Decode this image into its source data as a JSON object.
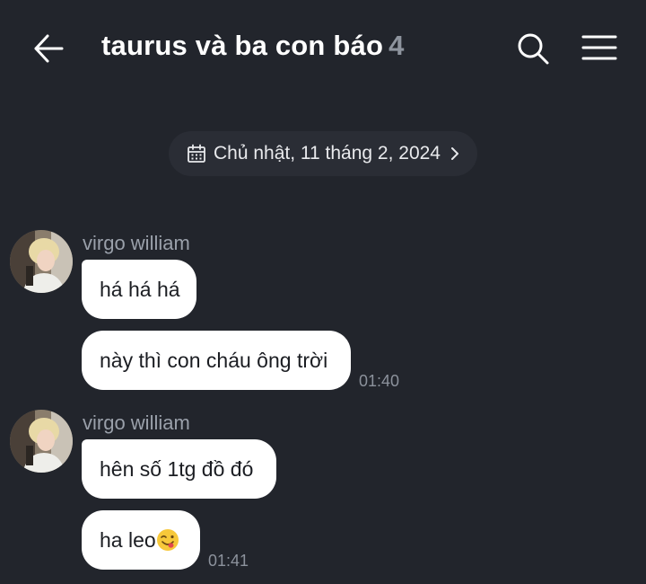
{
  "header": {
    "title": "taurus và ba con báo",
    "member_count": "4",
    "back_icon": "arrow-left-icon",
    "search_icon": "search-icon",
    "menu_icon": "hamburger-menu-icon"
  },
  "date_separator": {
    "label": "Chủ nhật, 11 tháng 2, 2024",
    "icon": "calendar-icon"
  },
  "colors": {
    "background": "#22252c",
    "bubble": "#ffffff",
    "sender_name": "#9aa0aa",
    "muted_count": "#8e949e"
  },
  "messages": [
    {
      "sender": "virgo william",
      "bubbles": [
        {
          "text": "há há há"
        },
        {
          "text": "này thì con cháu ông trời"
        }
      ],
      "time": "01:40"
    },
    {
      "sender": "virgo william",
      "bubbles": [
        {
          "text": "hên số 1tg đồ đó"
        },
        {
          "text": "ha leo",
          "emoji": "face-savoring-food-emoji"
        }
      ],
      "time": "01:41"
    }
  ]
}
